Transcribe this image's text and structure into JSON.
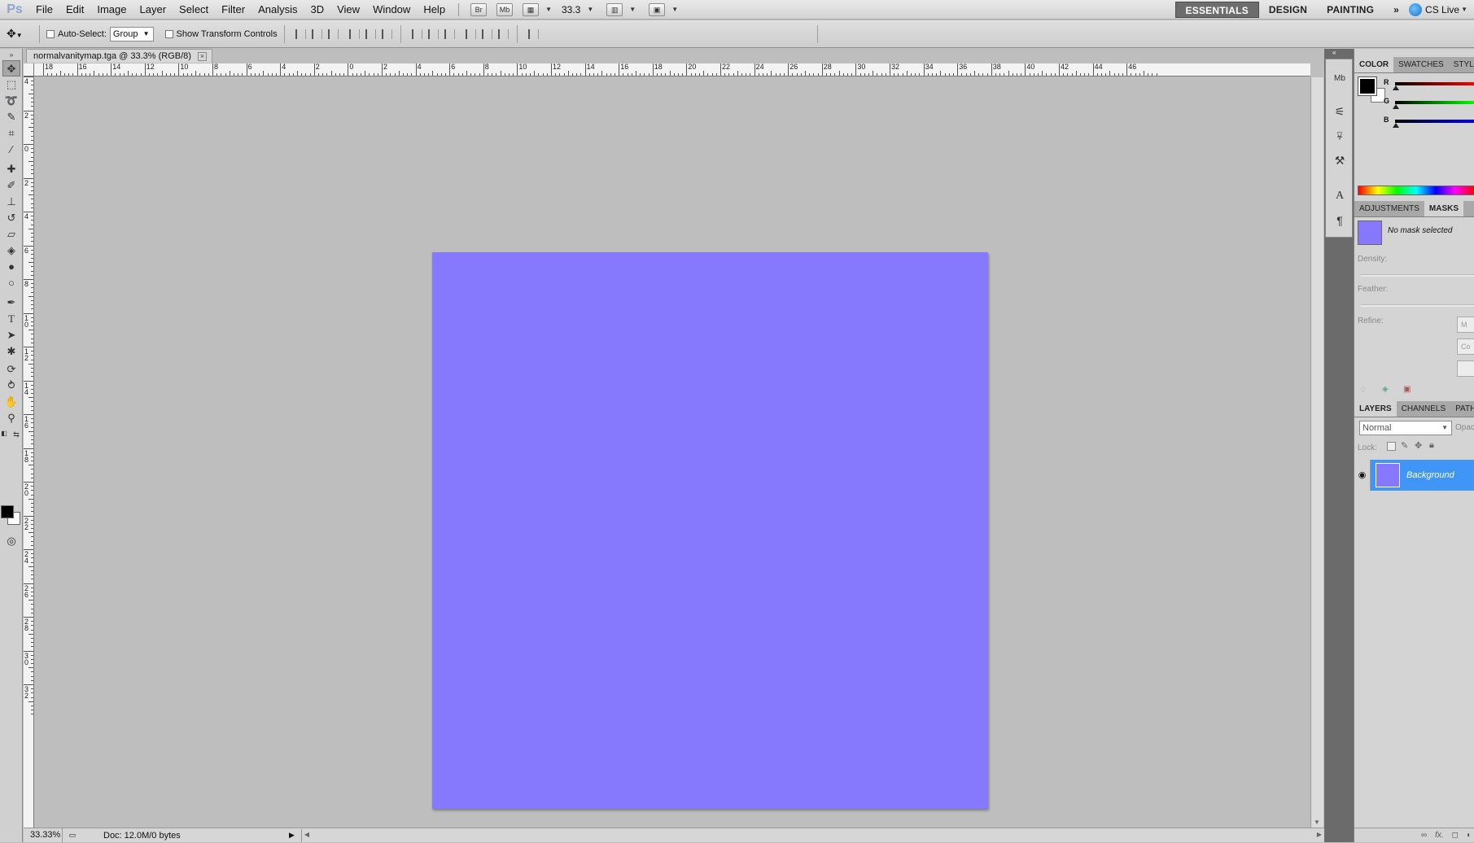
{
  "app": {
    "logo": "Ps"
  },
  "menu": [
    "File",
    "Edit",
    "Image",
    "Layer",
    "Select",
    "Filter",
    "Analysis",
    "3D",
    "View",
    "Window",
    "Help"
  ],
  "appbar": {
    "bridge_label": "Br",
    "minibridge_label": "Mb",
    "zoom_value": "33.3"
  },
  "workspaces": {
    "essentials": "ESSENTIALS",
    "design": "DESIGN",
    "painting": "PAINTING",
    "more": "»",
    "cslive": "CS Live"
  },
  "options": {
    "auto_select_label": "Auto-Select:",
    "auto_select_value": "Group",
    "transform_label": "Show Transform Controls"
  },
  "document": {
    "tab_title": "normalvanitymap.tga @ 33.3% (RGB/8)",
    "close": "×",
    "canvas_color": "#8679fe"
  },
  "rulers": {
    "top": [
      "18",
      "16",
      "14",
      "12",
      "10",
      "8",
      "6",
      "4",
      "2",
      "0",
      "2",
      "4",
      "6",
      "8",
      "10",
      "12",
      "14",
      "16",
      "18",
      "20",
      "22",
      "24",
      "26",
      "28",
      "30",
      "32",
      "34",
      "36",
      "38",
      "40",
      "42",
      "44",
      "46"
    ],
    "left": [
      "4",
      "2",
      "0",
      "2",
      "4",
      "6",
      "8",
      "10",
      "12",
      "14",
      "16",
      "18",
      "20",
      "22",
      "24",
      "26",
      "28",
      "30",
      "32"
    ]
  },
  "status": {
    "zoom": "33.33%",
    "doc": "Doc: 12.0M/0 bytes"
  },
  "panels": {
    "color_tabs": [
      "COLOR",
      "SWATCHES",
      "STYLES"
    ],
    "channels": [
      "R",
      "G",
      "B"
    ],
    "adjust_tabs": [
      "ADJUSTMENTS",
      "MASKS"
    ],
    "mask_status": "No mask selected",
    "density_label": "Density:",
    "feather_label": "Feather:",
    "refine_label": "Refine:",
    "refine_buttons": [
      "M",
      "Co",
      ""
    ],
    "layers_tabs": [
      "LAYERS",
      "CHANNELS",
      "PATHS"
    ],
    "blend_mode": "Normal",
    "opacity_label": "Opac",
    "lock_label": "Lock:",
    "layer_name": "Background"
  },
  "colors": {
    "foreground": "#000000",
    "background": "#ffffff",
    "layer_selected": "#3f96f6"
  }
}
